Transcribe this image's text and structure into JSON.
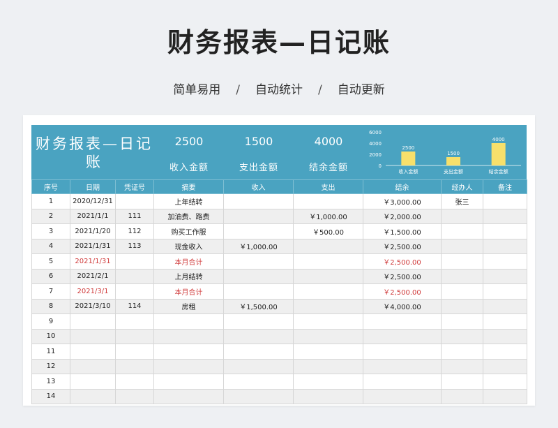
{
  "page": {
    "title": "财务报表—日记账",
    "subtitle_parts": [
      "简单易用",
      "自动统计",
      "自动更新"
    ],
    "separator": "/"
  },
  "banner": {
    "title": "财务报表—日记账",
    "kpis": [
      {
        "value": "2500",
        "label": "收入金额"
      },
      {
        "value": "1500",
        "label": "支出金额"
      },
      {
        "value": "4000",
        "label": "结余金额"
      }
    ]
  },
  "chart_data": {
    "type": "bar",
    "categories": [
      "收入金额",
      "支出金额",
      "结余金额"
    ],
    "values": [
      2500,
      1500,
      4000
    ],
    "ylim": [
      0,
      6000
    ],
    "yticks": [
      0,
      2000,
      4000,
      6000
    ],
    "bar_color": "#f7e06b",
    "grid": false
  },
  "table": {
    "headers": [
      "序号",
      "日期",
      "凭证号",
      "摘要",
      "收入",
      "支出",
      "结余",
      "经办人",
      "备注"
    ],
    "rows": [
      {
        "cells": [
          "1",
          "2020/12/31",
          "",
          "上年结转",
          "",
          "",
          "￥3,000.00",
          "张三",
          ""
        ],
        "red": false
      },
      {
        "cells": [
          "2",
          "2021/1/1",
          "111",
          "加油费、路费",
          "",
          "￥1,000.00",
          "￥2,000.00",
          "",
          ""
        ],
        "red": false
      },
      {
        "cells": [
          "3",
          "2021/1/20",
          "112",
          "购买工作服",
          "",
          "￥500.00",
          "￥1,500.00",
          "",
          ""
        ],
        "red": false
      },
      {
        "cells": [
          "4",
          "2021/1/31",
          "113",
          "现金收入",
          "￥1,000.00",
          "",
          "￥2,500.00",
          "",
          ""
        ],
        "red": false
      },
      {
        "cells": [
          "5",
          "2021/1/31",
          "",
          "本月合计",
          "",
          "",
          "￥2,500.00",
          "",
          ""
        ],
        "red": true
      },
      {
        "cells": [
          "6",
          "2021/2/1",
          "",
          "上月结转",
          "",
          "",
          "￥2,500.00",
          "",
          ""
        ],
        "red": false
      },
      {
        "cells": [
          "7",
          "2021/3/1",
          "",
          "本月合计",
          "",
          "",
          "￥2,500.00",
          "",
          ""
        ],
        "red": true
      },
      {
        "cells": [
          "8",
          "2021/3/10",
          "114",
          "房租",
          "￥1,500.00",
          "",
          "￥4,000.00",
          "",
          ""
        ],
        "red": false
      },
      {
        "cells": [
          "9",
          "",
          "",
          "",
          "",
          "",
          "",
          "",
          ""
        ],
        "red": false
      },
      {
        "cells": [
          "10",
          "",
          "",
          "",
          "",
          "",
          "",
          "",
          ""
        ],
        "red": false
      },
      {
        "cells": [
          "11",
          "",
          "",
          "",
          "",
          "",
          "",
          "",
          ""
        ],
        "red": false
      },
      {
        "cells": [
          "12",
          "",
          "",
          "",
          "",
          "",
          "",
          "",
          ""
        ],
        "red": false
      },
      {
        "cells": [
          "13",
          "",
          "",
          "",
          "",
          "",
          "",
          "",
          ""
        ],
        "red": false
      },
      {
        "cells": [
          "14",
          "",
          "",
          "",
          "",
          "",
          "",
          "",
          ""
        ],
        "red": false
      }
    ]
  },
  "colors": {
    "accent": "#4aa3c1",
    "bar": "#f7e06b",
    "red_text": "#d03b3b"
  }
}
